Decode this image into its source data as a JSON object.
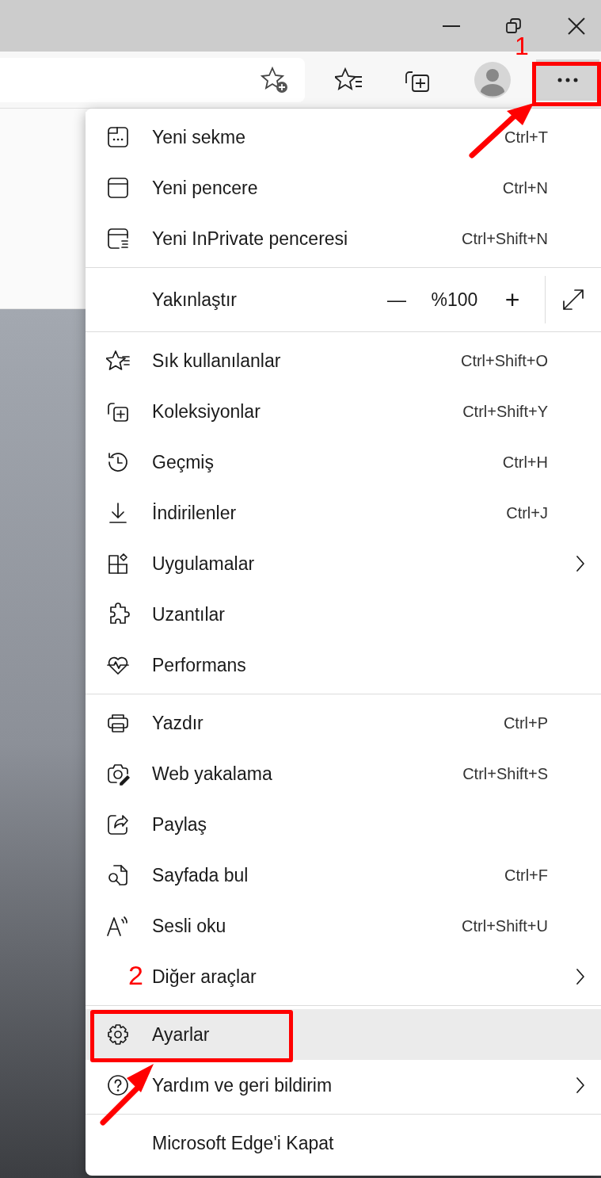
{
  "menu": {
    "sections": [
      {
        "items": [
          {
            "kind": "item",
            "label": "Yeni sekme",
            "shortcut": "Ctrl+T",
            "submenu": false,
            "highlighted": false
          },
          {
            "kind": "item",
            "label": "Yeni pencere",
            "shortcut": "Ctrl+N",
            "submenu": false,
            "highlighted": false
          },
          {
            "kind": "item",
            "label": "Yeni InPrivate penceresi",
            "shortcut": "Ctrl+Shift+N",
            "submenu": false,
            "highlighted": false
          }
        ]
      },
      {
        "items": [
          {
            "kind": "zoom",
            "label": "Yakınlaştır",
            "minus": "—",
            "value": "%100",
            "plus": "+"
          }
        ]
      },
      {
        "items": [
          {
            "kind": "item",
            "label": "Sık kullanılanlar",
            "shortcut": "Ctrl+Shift+O",
            "submenu": false,
            "highlighted": false
          },
          {
            "kind": "item",
            "label": "Koleksiyonlar",
            "shortcut": "Ctrl+Shift+Y",
            "submenu": false,
            "highlighted": false
          },
          {
            "kind": "item",
            "label": "Geçmiş",
            "shortcut": "Ctrl+H",
            "submenu": false,
            "highlighted": false
          },
          {
            "kind": "item",
            "label": "İndirilenler",
            "shortcut": "Ctrl+J",
            "submenu": false,
            "highlighted": false
          },
          {
            "kind": "item",
            "label": "Uygulamalar",
            "submenu": true,
            "highlighted": false
          },
          {
            "kind": "item",
            "label": "Uzantılar",
            "submenu": false,
            "highlighted": false
          },
          {
            "kind": "item",
            "label": "Performans",
            "submenu": false,
            "highlighted": false
          }
        ]
      },
      {
        "items": [
          {
            "kind": "item",
            "label": "Yazdır",
            "shortcut": "Ctrl+P",
            "submenu": false,
            "highlighted": false
          },
          {
            "kind": "item",
            "label": "Web yakalama",
            "shortcut": "Ctrl+Shift+S",
            "submenu": false,
            "highlighted": false
          },
          {
            "kind": "item",
            "label": "Paylaş",
            "submenu": false,
            "highlighted": false
          },
          {
            "kind": "item",
            "label": "Sayfada bul",
            "shortcut": "Ctrl+F",
            "submenu": false,
            "highlighted": false
          },
          {
            "kind": "item",
            "label": "Sesli oku",
            "shortcut": "Ctrl+Shift+U",
            "submenu": false,
            "highlighted": false
          },
          {
            "kind": "item",
            "label": "Diğer araçlar",
            "submenu": true,
            "highlighted": false
          }
        ]
      },
      {
        "items": [
          {
            "kind": "item",
            "label": "Ayarlar",
            "submenu": false,
            "highlighted": true
          },
          {
            "kind": "item",
            "label": "Yardım ve geri bildirim",
            "submenu": true,
            "highlighted": false
          }
        ]
      },
      {
        "items": [
          {
            "kind": "item",
            "label": "Microsoft Edge'i Kapat",
            "submenu": false,
            "highlighted": false
          }
        ]
      }
    ]
  },
  "annotations": [
    {
      "label": "1"
    },
    {
      "label": "2"
    }
  ]
}
